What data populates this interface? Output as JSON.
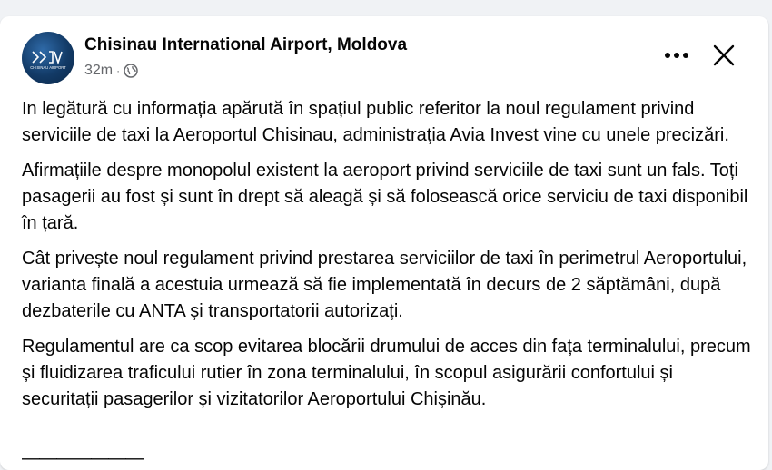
{
  "post": {
    "page_name": "Chisinau International Airport, Moldova",
    "timestamp": "32m",
    "separator": "·",
    "privacy_icon": "globe-icon",
    "avatar_text": "CHISINAU AIRPORT",
    "paragraphs": [
      "In legătură cu informația apărută în spațiul public referitor la noul regulament privind serviciile de taxi la Aeroportul Chisinau, administrația Avia Invest vine cu unele precizări.",
      "Afirmațiile despre monopolul existent la aeroport privind serviciile de taxi sunt un fals. Toți pasagerii au fost și sunt în drept să aleagă și să folosească orice serviciu de taxi disponibil în țară.",
      "Cât privește noul regulament privind prestarea serviciilor de taxi în perimetrul Aeroportului, varianta finală a acestuia urmează să fie implementată în decurs de 2 săptămâni, după dezbaterile cu ANTA și transportatorii autorizați.",
      "Regulamentul are ca scop evitarea blocării drumului de acces din fața terminalului, precum și fluidizarea traficului rutier în zona terminalului, în scopul asigurării confortului și securitații pasagerilor și vizitatorilor Aeroportului Chișinău."
    ],
    "divider": "———————"
  },
  "actions": {
    "more_icon": "more-options-icon",
    "close_icon": "close-icon"
  },
  "colors": {
    "secondary_text": "#65676b",
    "avatar_blue": "#123a66"
  }
}
